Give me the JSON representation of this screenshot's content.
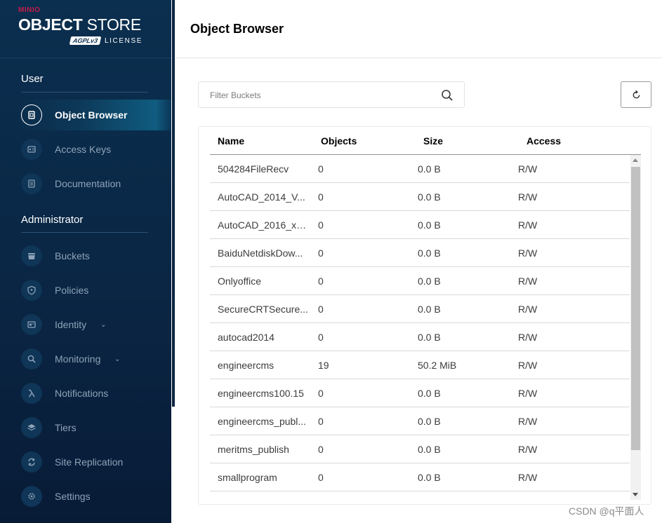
{
  "brand": {
    "minio": "MINIO",
    "product_bold": "OBJECT",
    "product_thin": " STORE",
    "agpl": "AGPLv3",
    "license": "LICENSE"
  },
  "sidebar": {
    "user_section": "User",
    "admin_section": "Administrator",
    "user_items": [
      {
        "label": "Object Browser",
        "icon": "object-browser-icon",
        "active": true
      },
      {
        "label": "Access Keys",
        "icon": "access-keys-icon"
      },
      {
        "label": "Documentation",
        "icon": "documentation-icon"
      }
    ],
    "admin_items": [
      {
        "label": "Buckets",
        "icon": "buckets-icon"
      },
      {
        "label": "Policies",
        "icon": "policies-icon"
      },
      {
        "label": "Identity",
        "icon": "identity-icon",
        "expandable": true
      },
      {
        "label": "Monitoring",
        "icon": "monitoring-icon",
        "expandable": true
      },
      {
        "label": "Notifications",
        "icon": "lambda-icon"
      },
      {
        "label": "Tiers",
        "icon": "tiers-icon"
      },
      {
        "label": "Site Replication",
        "icon": "site-replication-icon"
      },
      {
        "label": "Settings",
        "icon": "settings-icon"
      }
    ]
  },
  "header": {
    "title": "Object Browser"
  },
  "filter": {
    "placeholder": "Filter Buckets"
  },
  "table": {
    "columns": [
      "Name",
      "Objects",
      "Size",
      "Access"
    ],
    "rows": [
      {
        "name": "504284FileRecv",
        "objects": "0",
        "size": "0.0 B",
        "access": "R/W"
      },
      {
        "name": "AutoCAD_2014_V...",
        "objects": "0",
        "size": "0.0 B",
        "access": "R/W"
      },
      {
        "name": "AutoCAD_2016_x6...",
        "objects": "0",
        "size": "0.0 B",
        "access": "R/W"
      },
      {
        "name": "BaiduNetdiskDow...",
        "objects": "0",
        "size": "0.0 B",
        "access": "R/W"
      },
      {
        "name": "Onlyoffice",
        "objects": "0",
        "size": "0.0 B",
        "access": "R/W"
      },
      {
        "name": "SecureCRTSecure...",
        "objects": "0",
        "size": "0.0 B",
        "access": "R/W"
      },
      {
        "name": "autocad2014",
        "objects": "0",
        "size": "0.0 B",
        "access": "R/W"
      },
      {
        "name": "engineercms",
        "objects": "19",
        "size": "50.2 MiB",
        "access": "R/W"
      },
      {
        "name": "engineercms100.15",
        "objects": "0",
        "size": "0.0 B",
        "access": "R/W"
      },
      {
        "name": "engineercms_publ...",
        "objects": "0",
        "size": "0.0 B",
        "access": "R/W"
      },
      {
        "name": "meritms_publish",
        "objects": "0",
        "size": "0.0 B",
        "access": "R/W"
      },
      {
        "name": "smallprogram",
        "objects": "0",
        "size": "0.0 B",
        "access": "R/W"
      }
    ]
  },
  "watermark": "CSDN @q平面人",
  "colors": {
    "sidebar_bg": "#0b2f4f",
    "brand_red": "#c51d4a",
    "active_item": "#0f5c80"
  }
}
